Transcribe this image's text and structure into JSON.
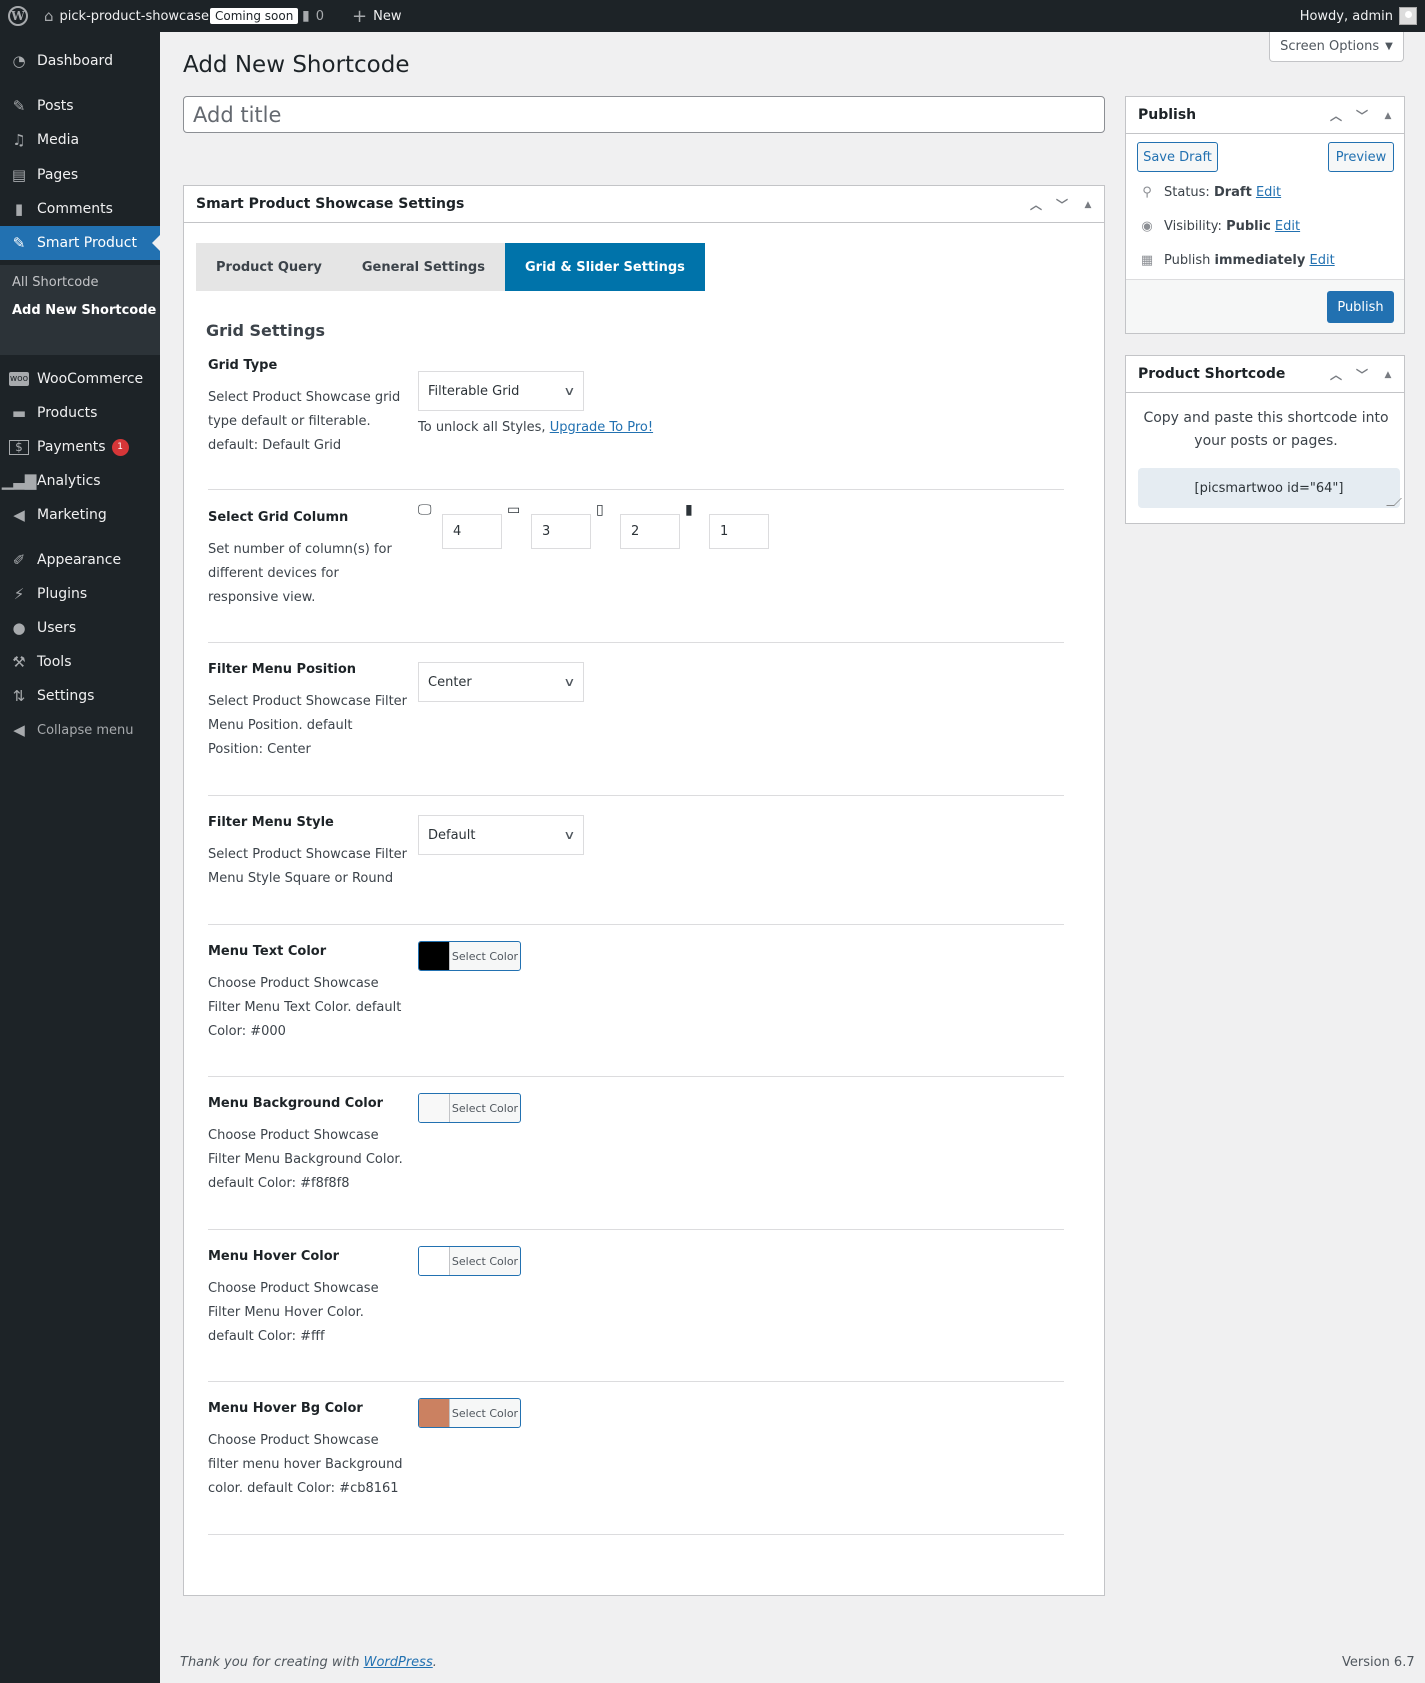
{
  "topbar": {
    "site_name": "pick-product-showcase",
    "coming_soon": "Coming soon",
    "comments_count": "0",
    "new_label": "New",
    "howdy": "Howdy, admin"
  },
  "sidebar": {
    "items": [
      {
        "label": "Dashboard",
        "icon": "dashboard-icon"
      },
      {
        "label": "Posts",
        "icon": "pin-icon"
      },
      {
        "label": "Media",
        "icon": "media-icon"
      },
      {
        "label": "Pages",
        "icon": "pages-icon"
      },
      {
        "label": "Comments",
        "icon": "comment-icon"
      },
      {
        "label": "Smart Product",
        "icon": "pin-icon",
        "active": true
      },
      {
        "label": "WooCommerce",
        "icon": "woo-icon"
      },
      {
        "label": "Products",
        "icon": "archive-icon"
      },
      {
        "label": "Payments",
        "icon": "dollar-icon",
        "badge": "1"
      },
      {
        "label": "Analytics",
        "icon": "bar-chart-icon"
      },
      {
        "label": "Marketing",
        "icon": "megaphone-icon"
      },
      {
        "label": "Appearance",
        "icon": "paintbrush-icon"
      },
      {
        "label": "Plugins",
        "icon": "plug-icon"
      },
      {
        "label": "Users",
        "icon": "user-icon"
      },
      {
        "label": "Tools",
        "icon": "wrench-icon"
      },
      {
        "label": "Settings",
        "icon": "sliders-icon"
      },
      {
        "label": "Collapse menu",
        "icon": "collapse-icon"
      }
    ],
    "submenu": [
      "All Shortcode",
      "Add New Shortcode"
    ]
  },
  "screen_options": "Screen Options",
  "page": {
    "title": "Add New Shortcode",
    "title_placeholder": "Add title",
    "title_value": ""
  },
  "settings_box": {
    "title": "Smart Product Showcase Settings",
    "tabs": [
      "Product Query",
      "General Settings",
      "Grid & Slider Settings"
    ],
    "active_tab": "Grid & Slider Settings",
    "section_heading": "Grid Settings",
    "grid_type": {
      "label": "Grid Type",
      "desc": "Select Product Showcase grid type default or filterable. default: Default Grid",
      "value": "Filterable Grid",
      "upgrade_text": "To unlock all Styles,",
      "upgrade_link": "Upgrade To Pro!"
    },
    "grid_column": {
      "label": "Select Grid Column",
      "desc": "Set number of column(s) for different devices for responsive view.",
      "devices": [
        {
          "icon": "desktop-icon",
          "value": "4"
        },
        {
          "icon": "laptop-icon",
          "value": "3"
        },
        {
          "icon": "tablet-icon",
          "value": "2"
        },
        {
          "icon": "mobile-icon",
          "value": "1"
        }
      ]
    },
    "filter_position": {
      "label": "Filter Menu Position",
      "desc": "Select Product Showcase Filter Menu Position. default Position: Center",
      "value": "Center"
    },
    "filter_style": {
      "label": "Filter Menu Style",
      "desc": "Select Product Showcase Filter Menu Style Square or Round",
      "value": "Default"
    },
    "colors": [
      {
        "label": "Menu Text Color",
        "desc": "Choose Product Showcase Filter Menu Text Color. default Color: #000",
        "color": "#000000",
        "button": "Select Color"
      },
      {
        "label": "Menu Background Color",
        "desc": "Choose Product Showcase Filter Menu Background Color. default Color: #f8f8f8",
        "color": "#f8f8f8",
        "button": "Select Color"
      },
      {
        "label": "Menu Hover Color",
        "desc": "Choose Product Showcase Filter Menu Hover Color. default Color: #fff",
        "color": "#ffffff",
        "button": "Select Color"
      },
      {
        "label": "Menu Hover Bg Color",
        "desc": "Choose Product Showcase filter menu hover Background color. default Color: #cb8161",
        "color": "#cb8161",
        "button": "Select Color"
      }
    ]
  },
  "publish_box": {
    "title": "Publish",
    "save_draft": "Save Draft",
    "preview": "Preview",
    "status_label": "Status:",
    "status_value": "Draft",
    "visibility_label": "Visibility:",
    "visibility_value": "Public",
    "publish_label": "Publish",
    "publish_value": "immediately",
    "edit": "Edit",
    "publish_button": "Publish"
  },
  "shortcode_box": {
    "title": "Product Shortcode",
    "text": "Copy and paste this shortcode into your posts or pages.",
    "code": "[picsmartwoo id=\"64\"]"
  },
  "footer": {
    "thanks": "Thank you for creating with",
    "link": "WordPress",
    "version": "Version 6.7"
  },
  "colors": {
    "accent": "#2271b1",
    "tab_active": "#0073aa",
    "admin_bar": "#1d2327",
    "badge": "#d63638"
  }
}
